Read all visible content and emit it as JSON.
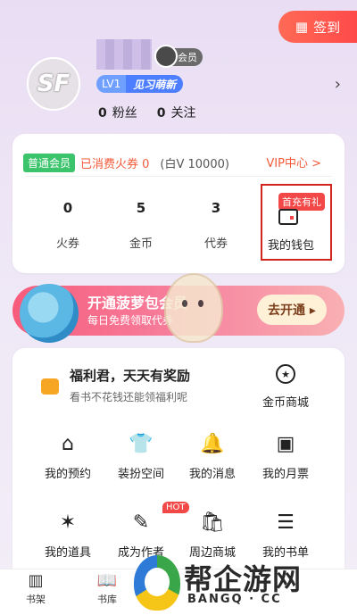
{
  "header": {
    "signin_label": "签到",
    "member_tag": "会员",
    "level": "LV1",
    "level_title": "见习萌新",
    "fans_count": "0",
    "fans_label": "粉丝",
    "follow_count": "0",
    "follow_label": "关注"
  },
  "wallet": {
    "membership": "普通会员",
    "spent": "已消费火券 0",
    "balance": "(白V 10000)",
    "vip_center": "VIP中心 >",
    "assets": [
      {
        "value": "0",
        "label": "火券"
      },
      {
        "value": "5",
        "label": "金币"
      },
      {
        "value": "3",
        "label": "代券"
      }
    ],
    "first_charge_tag": "首充有礼",
    "wallet_label": "我的钱包"
  },
  "banner": {
    "title": "开通菠萝包会员",
    "subtitle": "每日免费领取代券",
    "button": "去开通 ▸"
  },
  "welfare": {
    "title": "福利君，天天有奖励",
    "subtitle": "看书不花钱还能领福利呢",
    "coin_store": "金币商城",
    "grid": [
      {
        "label": "我的预约",
        "icon": "home-clock-icon"
      },
      {
        "label": "装扮空间",
        "icon": "shirt-icon"
      },
      {
        "label": "我的消息",
        "icon": "bell-icon"
      },
      {
        "label": "我的月票",
        "icon": "ticket-icon"
      },
      {
        "label": "我的道具",
        "icon": "wand-icon"
      },
      {
        "label": "成为作者",
        "icon": "author-icon"
      },
      {
        "label": "周边商城",
        "icon": "bag-icon"
      },
      {
        "label": "我的书单",
        "icon": "booklist-icon"
      }
    ],
    "hot_badge": "HOT"
  },
  "tabs": [
    {
      "label": "书架",
      "icon": "bookshelf-icon"
    },
    {
      "label": "书库",
      "icon": "open-book-icon"
    }
  ],
  "watermark": {
    "text": "帮企游网",
    "url": "BANGQ · CC"
  }
}
